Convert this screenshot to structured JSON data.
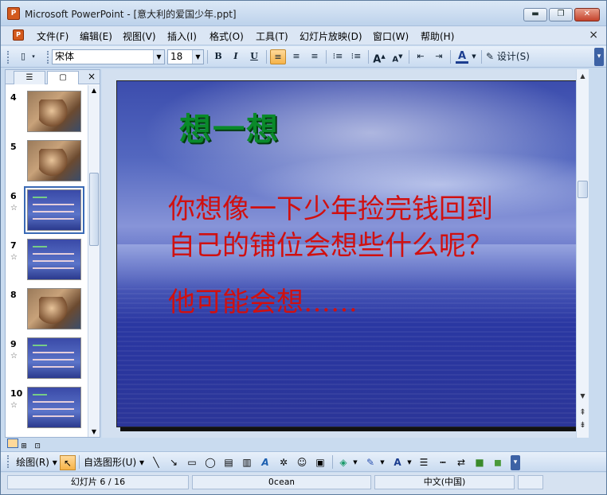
{
  "window": {
    "app_name": "Microsoft PowerPoint",
    "title": "Microsoft PowerPoint - [意大利的爱国少年.ppt]",
    "minimize": "▬",
    "restore": "❐",
    "close": "✕"
  },
  "menubar": {
    "items": [
      "文件(F)",
      "编辑(E)",
      "视图(V)",
      "插入(I)",
      "格式(O)",
      "工具(T)",
      "幻灯片放映(D)",
      "窗口(W)",
      "帮助(H)"
    ],
    "close": "×"
  },
  "toolbar": {
    "font": "宋体",
    "size": "18",
    "bold": "B",
    "italic": "I",
    "underline": "U",
    "design_label": "设计(S)",
    "font_color_letter": "A",
    "grow_label": "A",
    "shrink_label": "A"
  },
  "left_pane": {
    "tab_outline": "☰",
    "tab_slides": "▢",
    "close": "×",
    "slides": [
      {
        "number": "4",
        "kind": "pic",
        "star": false
      },
      {
        "number": "5",
        "kind": "pic",
        "star": false
      },
      {
        "number": "6",
        "kind": "blue",
        "star": true,
        "selected": true
      },
      {
        "number": "7",
        "kind": "blue",
        "star": true
      },
      {
        "number": "8",
        "kind": "pic",
        "star": false
      },
      {
        "number": "9",
        "kind": "blue",
        "star": true
      },
      {
        "number": "10",
        "kind": "blue",
        "star": true
      }
    ],
    "star_glyph": "☆"
  },
  "slide": {
    "title": "想一想",
    "body_lines": [
      "你想像一下少年捡完钱回到",
      "自己的铺位会想些什么呢？"
    ],
    "body2": "他可能会想……",
    "title_color": "#0a8a2a",
    "body_color": "#d01010"
  },
  "drawing_toolbar": {
    "draw_label": "绘图(R)",
    "autoshapes_label": "自选图形(U)"
  },
  "status": {
    "slide_info": "幻灯片 6 / 16",
    "design": "Ocean",
    "language": "中文(中国)"
  }
}
